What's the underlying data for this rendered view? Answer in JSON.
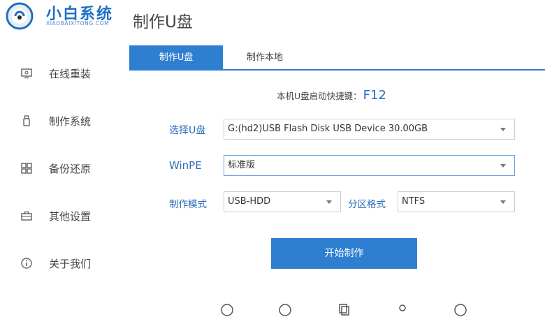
{
  "logo": {
    "name": "小白系统",
    "subtitle": "XIAOBAIXITONG.COM"
  },
  "page_title": "制作U盘",
  "sidebar": {
    "items": [
      {
        "label": "在线重装",
        "icon": "monitor-icon"
      },
      {
        "label": "制作系统",
        "icon": "usb-drive-icon"
      },
      {
        "label": "备份还原",
        "icon": "grid-icon"
      },
      {
        "label": "其他设置",
        "icon": "briefcase-icon"
      },
      {
        "label": "关于我们",
        "icon": "info-icon"
      }
    ]
  },
  "tabs": [
    {
      "label": "制作U盘",
      "active": true
    },
    {
      "label": "制作本地",
      "active": false
    }
  ],
  "hotkey": {
    "text": "本机U盘启动快捷键：",
    "key": "F12"
  },
  "form": {
    "usb": {
      "label": "选择U盘",
      "value": "G:(hd2)USB Flash Disk USB Device 30.00GB"
    },
    "winpe": {
      "label": "WinPE",
      "value": "标准版"
    },
    "mode": {
      "label": "制作模式",
      "value": "USB-HDD"
    },
    "partition": {
      "label": "分区格式",
      "value": "NTFS"
    }
  },
  "start_button": "开始制作",
  "colors": {
    "accent": "#2f7fd1",
    "brand": "#1e6fc4",
    "label": "#2f6fba"
  }
}
